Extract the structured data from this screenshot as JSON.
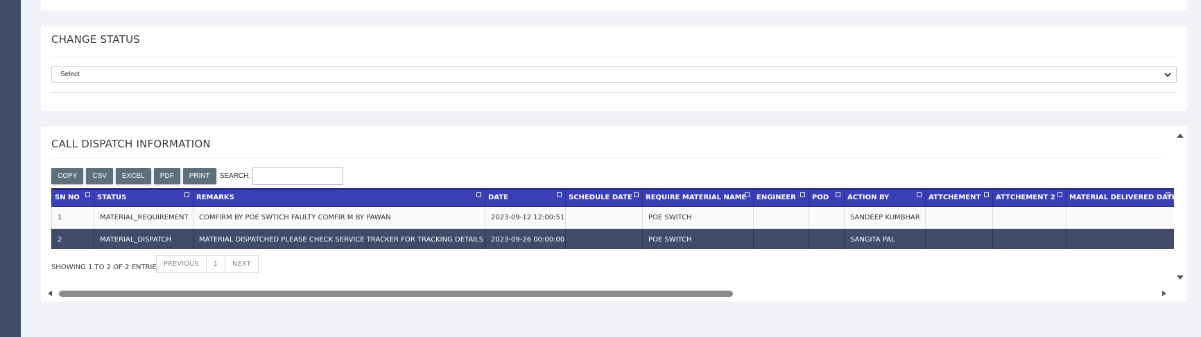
{
  "change_status": {
    "title": "CHANGE STATUS",
    "select_value": "Select"
  },
  "dispatch": {
    "title": "CALL DISPATCH INFORMATION",
    "buttons": {
      "copy": "COPY",
      "csv": "CSV",
      "excel": "EXCEL",
      "pdf": "PDF",
      "print": "PRINT"
    },
    "search_label": "SEARCH:",
    "search_value": "",
    "columns": [
      "SN NO",
      "STATUS",
      "REMARKS",
      "DATE",
      "SCHEDULE DATE",
      "REQUIRE MATERIAL NAME",
      "ENGINEER",
      "POD",
      "ACTION BY",
      "ATTCHEMENT",
      "ATTCHEMENT 2",
      "MATERIAL DELIVERED DATE"
    ],
    "rows": [
      [
        "1",
        "MATERIAL_REQUIREMENT",
        "COMFIRM BY POE SWTICH FAULTY COMFIR M BY PAWAN",
        "2023-09-12 12:00:51",
        "",
        "POE SWITCH",
        "",
        "",
        "SANDEEP KUMBHAR",
        "",
        "",
        ""
      ],
      [
        "2",
        "MATERIAL_DISPATCH",
        "MATERIAL DISPATCHED PLEASE CHECK SERVICE TRACKER FOR TRACKING DETAILS .",
        "2023-09-26 00:00:00",
        "",
        "POE SWITCH",
        "",
        "",
        "SANGITA PAL",
        "",
        "",
        ""
      ]
    ],
    "info": "SHOWING 1 TO 2 OF 2 ENTRIES",
    "pagination": {
      "previous": "PREVIOUS",
      "page": "1",
      "next": "NEXT"
    }
  },
  "colors": {
    "sidebar": "#3f4d67",
    "header": "#3b3fb6",
    "selected_row": "#3f4b68",
    "button": "#5d6f7b"
  }
}
